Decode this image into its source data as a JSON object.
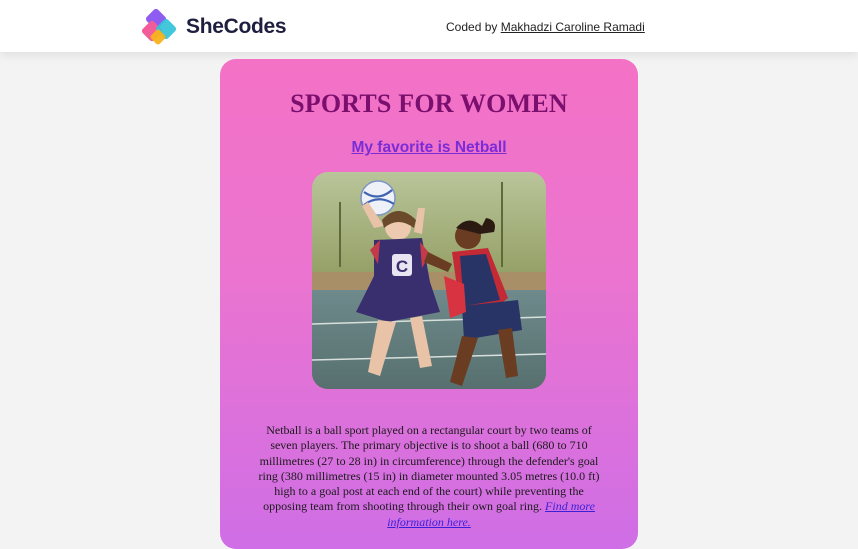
{
  "header": {
    "brand": "SheCodes",
    "coded_by_prefix": "Coded by ",
    "author": "Makhadzi Caroline Ramadi"
  },
  "card": {
    "title": "SPORTS FOR WOMEN",
    "subtitle": "My favorite is Netball",
    "description": "Netball is a ball sport played on a rectangular court by two teams of seven players. The primary objective is to shoot a ball (680 to 710 millimetres (27 to 28 in) in circumference) through the defender's goal ring (380 millimetres (15 in) in diameter mounted 3.05 metres (10.0 ft) high to a goal post at each end of the court) while preventing the opposing team from shooting through their own goal ring.",
    "more_link": "Find more information here."
  },
  "photo": {
    "player_letter": "C"
  },
  "colors": {
    "title": "#7a0f6e",
    "subtitle_link": "#7a2cd6",
    "card_top": "#f472c6",
    "card_bottom": "#cf6ee6",
    "desc_link": "#3b1fd6"
  }
}
